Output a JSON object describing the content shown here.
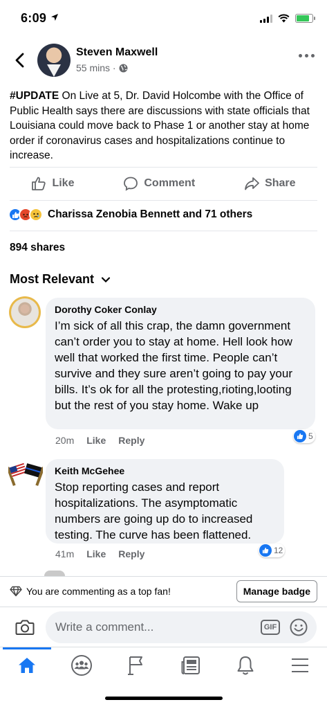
{
  "status_bar": {
    "time": "6:09",
    "location_arrow": "location-arrow-icon",
    "battery_color": "#35c759"
  },
  "post": {
    "author": "Steven Maxwell",
    "meta": "55 mins ·",
    "privacy_icon": "globe-icon",
    "tag": "#UPDATE",
    "body": " On Live at 5, Dr. David Holcombe with the Office of Public Health says there are discussions with state officials that Louisiana could move back to Phase 1 or another stay at home order if coronavirus cases and hospitalizations continue to increase.",
    "actions": {
      "like": "Like",
      "comment": "Comment",
      "share": "Share"
    },
    "reactions_text": "Charissa Zenobia Bennett and 71 others",
    "shares": "894 shares"
  },
  "sort": {
    "label": "Most Relevant"
  },
  "comments": [
    {
      "name": "Dorothy Coker Conlay",
      "text": "I’m sick of all this crap, the damn government can’t order you to stay at home. Hell look how well that worked the first time. People can’t survive and they sure aren’t going to pay your bills. It’s ok for all the protesting,rioting,looting but the rest of you stay home. Wake up",
      "time": "20m",
      "like": "Like",
      "reply": "Reply",
      "likes": "5"
    },
    {
      "name": "Keith McGehee",
      "text": "Stop reporting cases and report hospitalizations.  The asymptomatic numbers are going up do to increased testing.  The curve has been flattened.",
      "time": "41m",
      "like": "Like",
      "reply": "Reply",
      "likes": "12"
    }
  ],
  "top_fan": {
    "text": "You are commenting as a top fan!",
    "button": "Manage badge"
  },
  "composer": {
    "placeholder": "Write a comment...",
    "gif": "GIF"
  },
  "tabs": [
    "home-icon",
    "groups-icon",
    "pages-flag-icon",
    "news-icon",
    "bell-icon",
    "menu-icon"
  ],
  "colors": {
    "accent": "#1877f2",
    "secondary_text": "#65676b",
    "bubble": "#f0f2f5"
  }
}
